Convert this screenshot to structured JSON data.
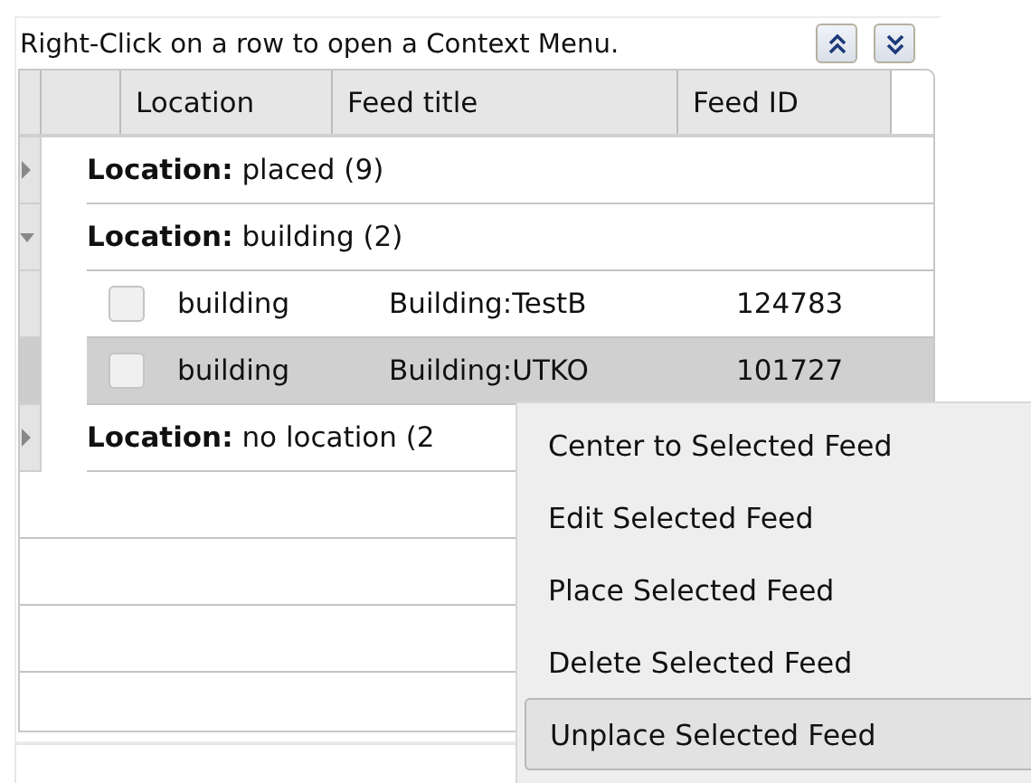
{
  "hint": "Right-Click on a row to open a Context Menu.",
  "toolbar_buttons": [
    {
      "kind": "up"
    },
    {
      "kind": "down"
    }
  ],
  "columns": [
    "Location",
    "Feed title",
    "Feed ID"
  ],
  "groups": [
    {
      "label": "**Location:** placed (9)",
      "expanded": false
    },
    {
      "label": "**Location:** building (2)",
      "expanded": true,
      "rows": [
        {
          "checked": false,
          "selected": false,
          "cells": [
            "building",
            "Building:TestB",
            "124783"
          ]
        },
        {
          "checked": false,
          "selected": true,
          "cells": [
            "building",
            "Building:UTKO",
            "101727"
          ]
        }
      ]
    },
    {
      "label": "**Location:** no location (2",
      "expanded": false
    }
  ],
  "context_menu": {
    "items": [
      {
        "label": "Center to Selected Feed",
        "highlighted": false
      },
      {
        "label": "Edit Selected Feed",
        "highlighted": false
      },
      {
        "label": "Place Selected Feed",
        "highlighted": false
      },
      {
        "label": "Delete Selected Feed",
        "highlighted": false
      },
      {
        "label": "Unplace Selected Feed",
        "highlighted": true
      }
    ]
  }
}
